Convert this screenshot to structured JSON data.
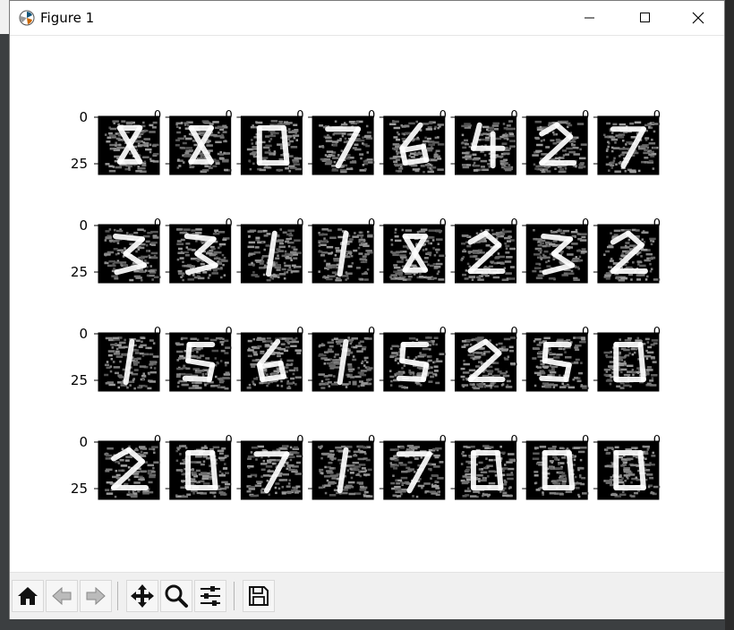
{
  "window": {
    "title": "Figure 1",
    "controls": [
      "minimize",
      "maximize",
      "close"
    ]
  },
  "figure": {
    "grid_rows": 4,
    "grid_cols": 8,
    "image_kind": "grayscale digit images",
    "y_ticks": [
      "0",
      "25"
    ],
    "x_tick_label": "0",
    "digits": [
      [
        "8",
        "8",
        "0",
        "7",
        "6",
        "4",
        "2",
        "7"
      ],
      [
        "3",
        "3",
        "1",
        "1",
        "8",
        "2",
        "3",
        "2"
      ],
      [
        "1",
        "5",
        "6",
        "1",
        "5",
        "2",
        "5",
        "0"
      ],
      [
        "2",
        "0",
        "7",
        "1",
        "7",
        "0",
        "0",
        "0"
      ]
    ]
  },
  "toolbar": {
    "buttons": [
      "home-icon",
      "back-icon",
      "forward-icon",
      "pan-icon",
      "zoom-icon",
      "configure-subplots-icon",
      "save-icon"
    ]
  },
  "colors": {
    "window_bg": "#ffffff",
    "toolbar_bg": "#f0f0f0",
    "image_bg": "#000000",
    "digit_fg": "#ffffff",
    "noise": "#777777"
  }
}
